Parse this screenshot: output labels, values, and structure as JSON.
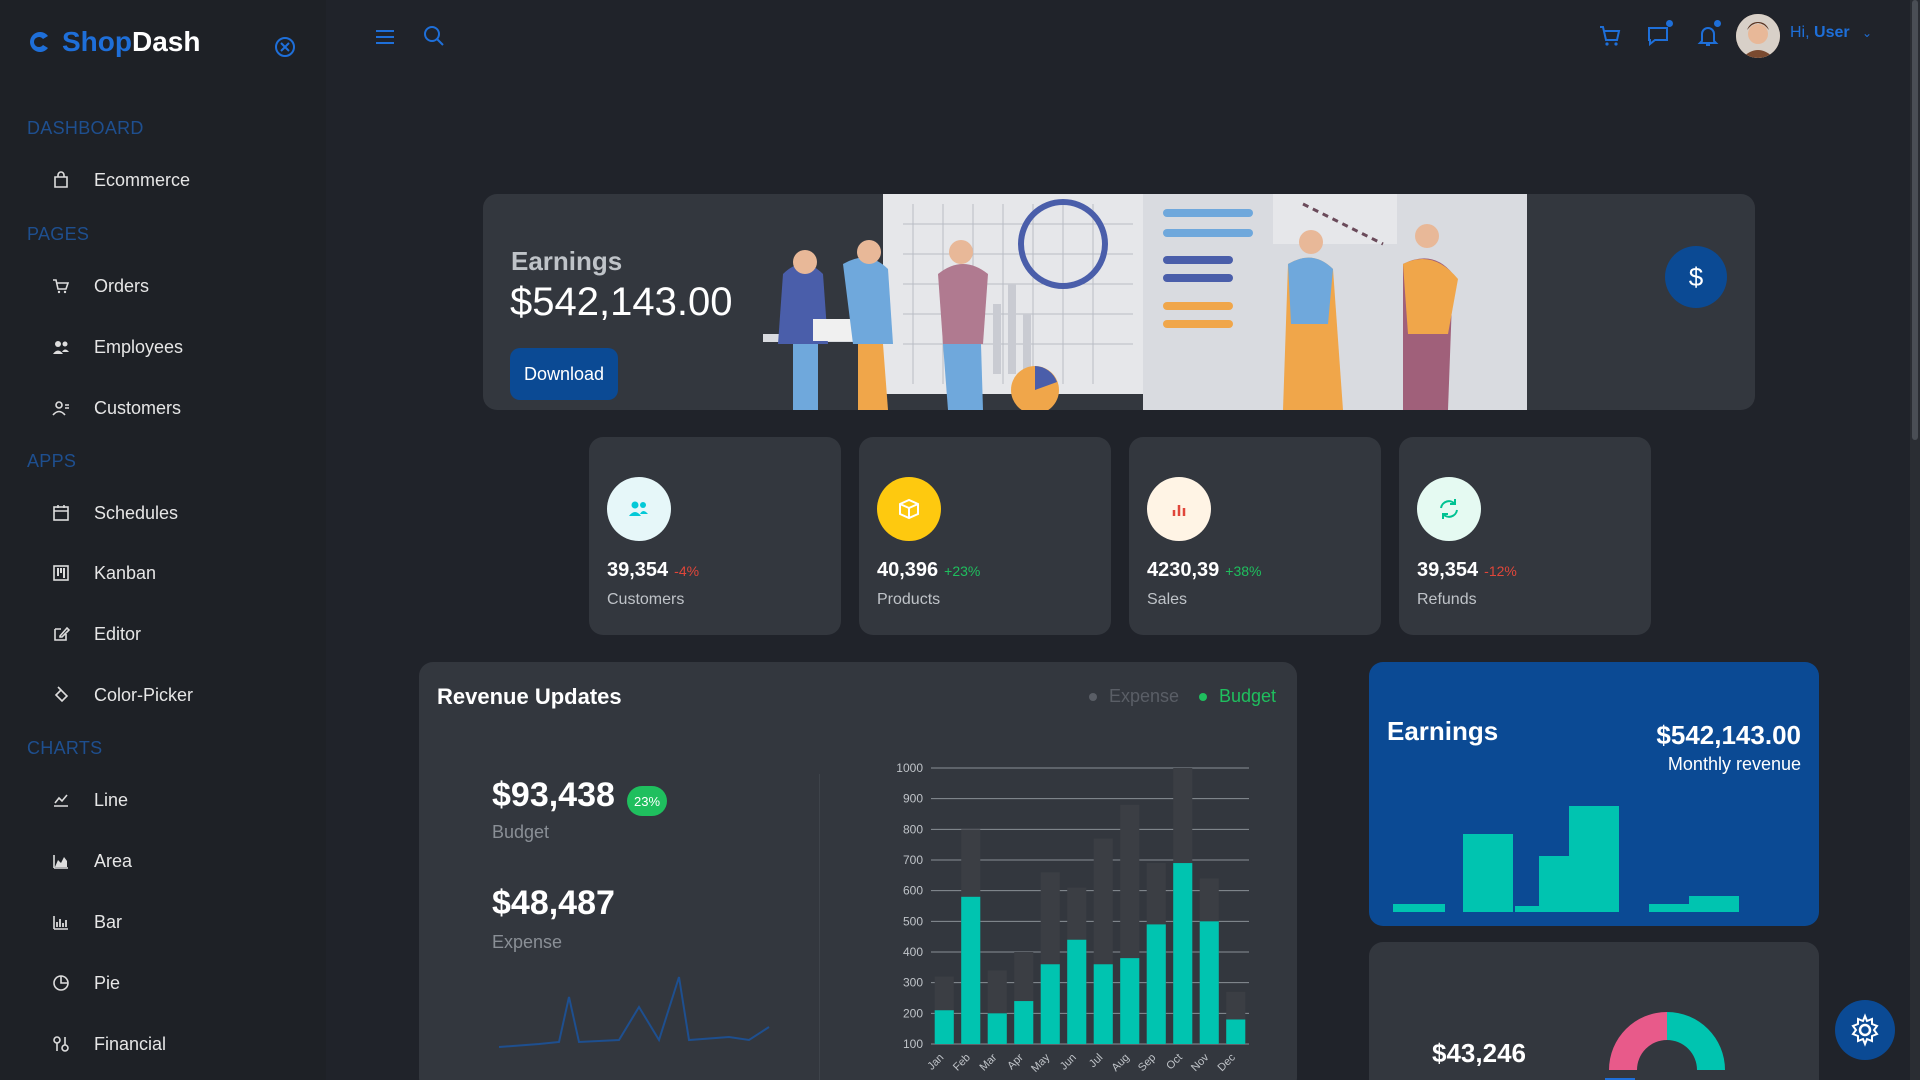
{
  "app": {
    "brand_a": "Shop",
    "brand_b": "Dash"
  },
  "sidebar": {
    "sections": [
      {
        "title": "DASHBOARD",
        "items": [
          {
            "label": "Ecommerce",
            "icon": "shopping-bag-icon"
          }
        ]
      },
      {
        "title": "PAGES",
        "items": [
          {
            "label": "Orders",
            "icon": "cart-icon"
          },
          {
            "label": "Employees",
            "icon": "people-icon"
          },
          {
            "label": "Customers",
            "icon": "user-icon"
          }
        ]
      },
      {
        "title": "APPS",
        "items": [
          {
            "label": "Schedules",
            "icon": "calendar-icon"
          },
          {
            "label": "Kanban",
            "icon": "kanban-icon"
          },
          {
            "label": "Editor",
            "icon": "edit-icon"
          },
          {
            "label": "Color-Picker",
            "icon": "color-bucket-icon"
          }
        ]
      },
      {
        "title": "CHARTS",
        "items": [
          {
            "label": "Line",
            "icon": "line-chart-icon"
          },
          {
            "label": "Area",
            "icon": "area-chart-icon"
          },
          {
            "label": "Bar",
            "icon": "bar-chart-icon"
          },
          {
            "label": "Pie",
            "icon": "pie-chart-icon"
          },
          {
            "label": "Financial",
            "icon": "financial-icon"
          }
        ]
      }
    ]
  },
  "topbar": {
    "greeting_prefix": "Hi,",
    "user_name": "User"
  },
  "earnings_banner": {
    "title": "Earnings",
    "value": "$542,143.00",
    "download_label": "Download",
    "dollar_symbol": "$"
  },
  "stats": [
    {
      "value": "39,354",
      "change": "-4%",
      "label": "Customers",
      "change_color": "#e0463a",
      "circle_color": "#e6f7f9",
      "icon_color": "#03c9d7",
      "icon": "people-icon"
    },
    {
      "value": "40,396",
      "change": "+23%",
      "label": "Products",
      "change_color": "#1fbf5e",
      "circle_color": "#fec90f",
      "icon_color": "#ffffff",
      "icon": "box-icon"
    },
    {
      "value": "4230,39",
      "change": "+38%",
      "label": "Sales",
      "change_color": "#1fbf5e",
      "circle_color": "#fff4e5",
      "icon_color": "#e0463a",
      "icon": "bar-chart-icon"
    },
    {
      "value": "39,354",
      "change": "-12%",
      "label": "Refunds",
      "change_color": "#e0463a",
      "circle_color": "#e5faf2",
      "icon_color": "#00c292",
      "icon": "refresh-icon"
    }
  ],
  "revenue": {
    "title": "Revenue Updates",
    "legend_expense": "Expense",
    "legend_budget": "Budget",
    "budget_value": "$93,438",
    "budget_badge": "23%",
    "budget_label": "Budget",
    "expense_value": "$48,487",
    "expense_label": "Expense"
  },
  "earnings_card": {
    "title": "Earnings",
    "value": "$542,143.00",
    "subtitle": "Monthly revenue"
  },
  "pie_card": {
    "value": "$43,246"
  },
  "chart_data": {
    "type": "bar",
    "x": [
      "Jan",
      "Feb",
      "Mar",
      "Apr",
      "May",
      "Jun",
      "Jul",
      "Aug",
      "Sep",
      "Oct",
      "Nov",
      "Dec"
    ],
    "tick_labels_y": [
      "1000",
      "900",
      "800",
      "700",
      "600",
      "500",
      "400",
      "300",
      "200",
      "100"
    ],
    "ylim": [
      100,
      1000
    ],
    "series": [
      {
        "name": "Budget",
        "color": "#00c4b0",
        "values": [
          210,
          580,
          200,
          240,
          360,
          440,
          360,
          380,
          490,
          690,
          500,
          180
        ]
      },
      {
        "name": "Expense",
        "color": "#3b3e44",
        "values": [
          320,
          800,
          340,
          400,
          660,
          610,
          770,
          880,
          690,
          1000,
          640,
          270
        ]
      }
    ]
  },
  "colors": {
    "accent": "#0b4a94",
    "brand": "#1e6fd9",
    "teal": "#00c4b0"
  }
}
